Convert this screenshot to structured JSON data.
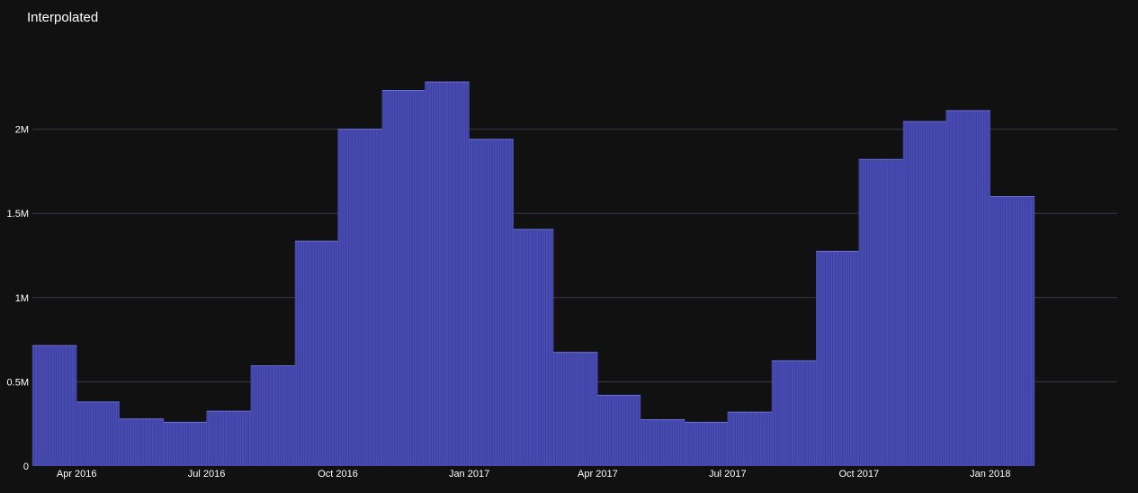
{
  "chart_data": {
    "type": "bar",
    "title": "Interpolated",
    "xlabel": "",
    "ylabel": "",
    "ylim": [
      0,
      2500000
    ],
    "grid": true,
    "bar_color": "#3d40a0",
    "bar_line_color": "#6a70e0",
    "background": "#111111",
    "grid_color": "#3a3a4a",
    "x_range": [
      "2016-03-01",
      "2018-03-31"
    ],
    "y_ticks": [
      {
        "value": 0,
        "label": "0"
      },
      {
        "value": 500000,
        "label": "0.5M"
      },
      {
        "value": 1000000,
        "label": "1M"
      },
      {
        "value": 1500000,
        "label": "1.5M"
      },
      {
        "value": 2000000,
        "label": "2M"
      }
    ],
    "x_ticks": [
      {
        "date": "2016-04-01",
        "label": "Apr 2016"
      },
      {
        "date": "2016-07-01",
        "label": "Jul 2016"
      },
      {
        "date": "2016-10-01",
        "label": "Oct 2016"
      },
      {
        "date": "2017-01-01",
        "label": "Jan 2017"
      },
      {
        "date": "2017-04-01",
        "label": "Apr 2017"
      },
      {
        "date": "2017-07-01",
        "label": "Jul 2017"
      },
      {
        "date": "2017-10-01",
        "label": "Oct 2017"
      },
      {
        "date": "2018-01-01",
        "label": "Jan 2018"
      }
    ],
    "series": [
      {
        "bins": [
          {
            "start": "2016-03-01",
            "end": "2016-04-01",
            "value": 715000
          },
          {
            "start": "2016-04-01",
            "end": "2016-05-01",
            "value": 380000
          },
          {
            "start": "2016-05-01",
            "end": "2016-06-01",
            "value": 280000
          },
          {
            "start": "2016-06-01",
            "end": "2016-07-01",
            "value": 260000
          },
          {
            "start": "2016-07-01",
            "end": "2016-08-01",
            "value": 325000
          },
          {
            "start": "2016-08-01",
            "end": "2016-09-01",
            "value": 595000
          },
          {
            "start": "2016-09-01",
            "end": "2016-10-01",
            "value": 1335000
          },
          {
            "start": "2016-10-01",
            "end": "2016-11-01",
            "value": 2000000
          },
          {
            "start": "2016-11-01",
            "end": "2016-12-01",
            "value": 2230000
          },
          {
            "start": "2016-12-01",
            "end": "2017-01-01",
            "value": 2280000
          },
          {
            "start": "2017-01-01",
            "end": "2017-02-01",
            "value": 1940000
          },
          {
            "start": "2017-02-01",
            "end": "2017-03-01",
            "value": 1405000
          },
          {
            "start": "2017-03-01",
            "end": "2017-04-01",
            "value": 675000
          },
          {
            "start": "2017-04-01",
            "end": "2017-05-01",
            "value": 420000
          },
          {
            "start": "2017-05-01",
            "end": "2017-06-01",
            "value": 275000
          },
          {
            "start": "2017-06-01",
            "end": "2017-07-01",
            "value": 260000
          },
          {
            "start": "2017-07-01",
            "end": "2017-08-01",
            "value": 320000
          },
          {
            "start": "2017-08-01",
            "end": "2017-09-01",
            "value": 625000
          },
          {
            "start": "2017-09-01",
            "end": "2017-10-01",
            "value": 1275000
          },
          {
            "start": "2017-10-01",
            "end": "2017-11-01",
            "value": 1820000
          },
          {
            "start": "2017-11-01",
            "end": "2017-12-01",
            "value": 2045000
          },
          {
            "start": "2017-12-01",
            "end": "2018-01-01",
            "value": 2110000
          },
          {
            "start": "2018-01-01",
            "end": "2018-02-01",
            "value": 1600000
          }
        ]
      }
    ]
  }
}
